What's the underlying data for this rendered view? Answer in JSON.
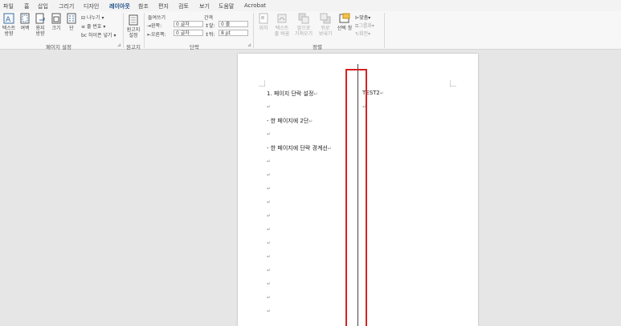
{
  "tabs": [
    "파일",
    "홈",
    "삽입",
    "그리기",
    "디자인",
    "레이아웃",
    "참조",
    "편지",
    "검토",
    "보기",
    "도움말",
    "Acrobat"
  ],
  "ribbon": {
    "page_setup": {
      "text_direction": [
        "텍스트",
        "방향"
      ],
      "margins": [
        "여백"
      ],
      "orientation": [
        "용지",
        "방향"
      ],
      "size": [
        "크기"
      ],
      "columns": [
        "단"
      ],
      "breaks": "나누기",
      "line_numbers": "줄 번호",
      "hyphenation": "하이픈 넣기",
      "group_label": "페이지 설정"
    },
    "draft": {
      "button": [
        "원고지",
        "설정"
      ],
      "group_label": "원고지"
    },
    "paragraph": {
      "indent_header": "들여쓰기",
      "spacing_header": "간격",
      "left_label": "왼쪽:",
      "left_value": "0 글자",
      "right_label": "오른쪽:",
      "right_value": "0 글자",
      "before_label": "앞:",
      "before_value": "0 줄",
      "after_label": "뒤:",
      "after_value": "8 pt",
      "group_label": "단락"
    },
    "arrange": {
      "position": [
        "위치"
      ],
      "wrap_text": [
        "텍스트",
        "줄 바꿈"
      ],
      "bring_forward": [
        "앞으로",
        "가져오기"
      ],
      "send_backward": [
        "뒤로",
        "보내기"
      ],
      "selection_pane": [
        "선택 창"
      ],
      "align": "맞춤",
      "group": "그룹화",
      "rotate": "회전",
      "group_label": "정렬"
    }
  },
  "document": {
    "col1_lines": [
      "1. 페이지 단락 설정",
      "",
      "- 한 페이지에 2단",
      "",
      "- 한 페이지에 단락 경계선",
      "",
      "",
      "",
      "",
      "",
      "",
      "",
      "",
      "",
      "",
      "",
      ""
    ],
    "col2_lines": [
      "TEST2",
      ""
    ],
    "para_mark": "↵"
  }
}
